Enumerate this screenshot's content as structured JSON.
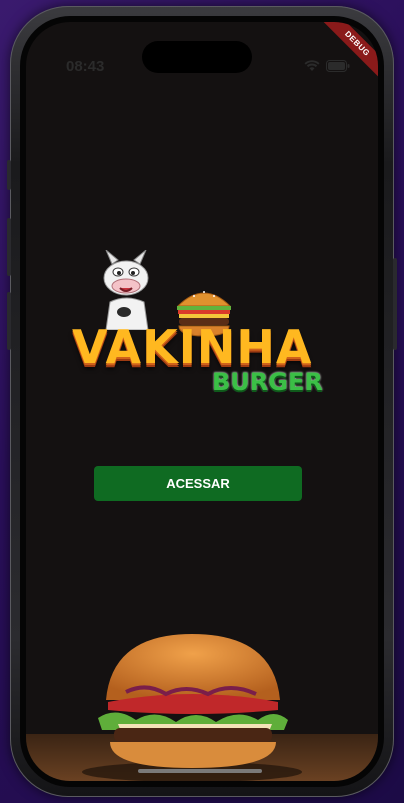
{
  "status_bar": {
    "time": "08:43",
    "debug_banner": "DEBUG"
  },
  "brand": {
    "name_main": "VAKINHA",
    "name_sub": "BURGER"
  },
  "actions": {
    "access_label": "ACESSAR"
  },
  "colors": {
    "background": "#141111",
    "button": "#0f6b22",
    "brand_orange": "#ffb820",
    "brand_green": "#3bbf46"
  },
  "icons": [
    "wifi-icon",
    "battery-icon",
    "cow-mascot",
    "burger-icon"
  ]
}
